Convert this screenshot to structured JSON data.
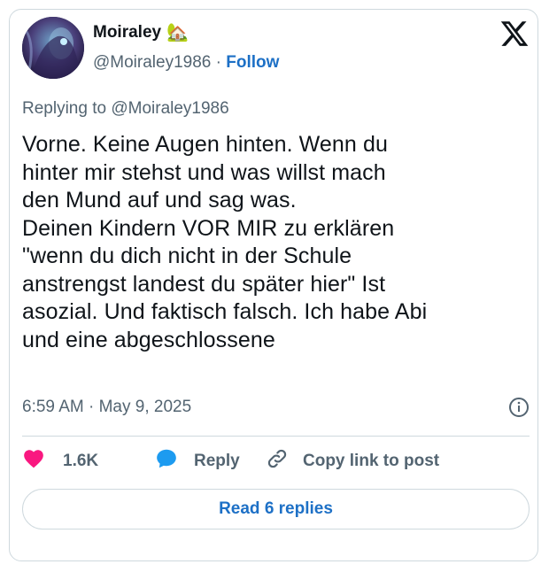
{
  "author": {
    "name": "Moiraley",
    "emoji": "🏡",
    "handle": "@Moiraley1986",
    "separator": "·",
    "follow_label": "Follow"
  },
  "replying_to": "Replying to @Moiraley1986",
  "text": "Vorne. Keine Augen hinten. Wenn du\nhinter mir stehst und was willst mach\nden Mund auf und sag was.\nDeinen Kindern VOR MIR zu erklären\n\"wenn du dich nicht in der Schule\nanstrengst landest du später hier\" Ist\nasozial. Und faktisch falsch. Ich habe Abi\nund eine abgeschlossene",
  "timestamp": "6:59 AM · May 9, 2025",
  "actions": {
    "likes": "1.6K",
    "reply_label": "Reply",
    "copy_label": "Copy link to post"
  },
  "read_replies_label": "Read 6 replies",
  "colors": {
    "accent": "#1d70c6",
    "like": "#f91880",
    "reply_icon": "#1d9bf0",
    "muted": "#536471",
    "border": "#cfd9de"
  },
  "icons": [
    "x-logo-icon",
    "info-icon",
    "heart-icon",
    "speech-bubble-icon",
    "link-icon",
    "house-icon"
  ]
}
